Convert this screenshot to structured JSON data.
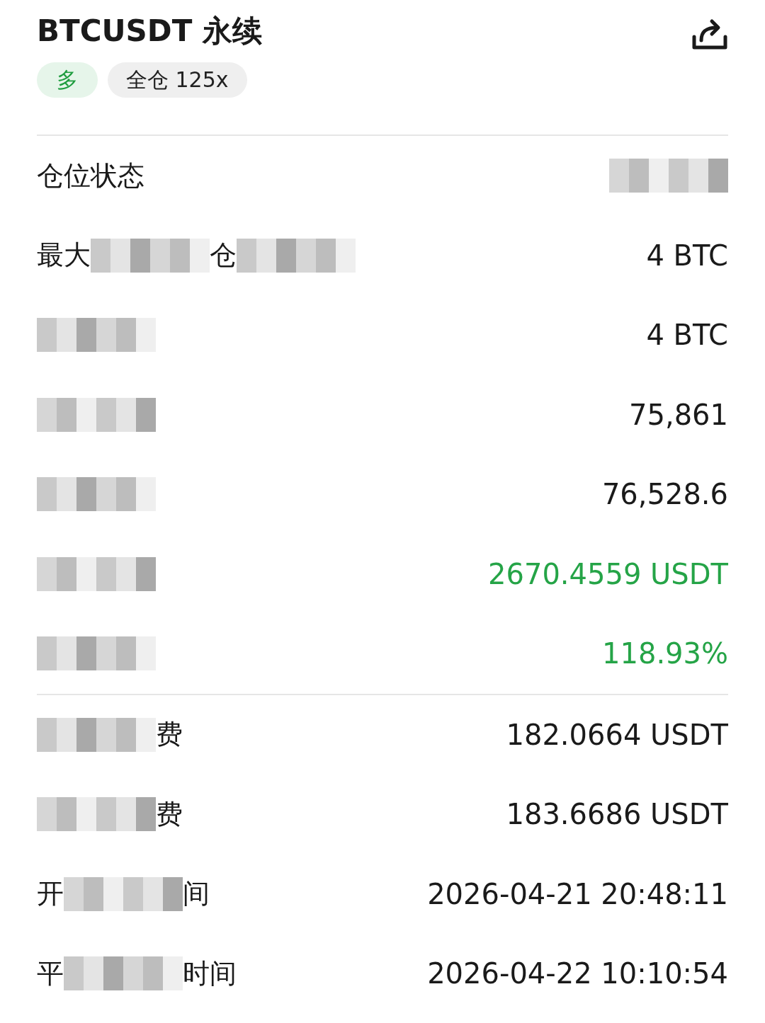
{
  "header": {
    "title": "BTCUSDT 永续",
    "side": "多",
    "margin_mode": "全仓 125x"
  },
  "sections": [
    {
      "rows": [
        {
          "label": [
            {
              "kind": "text",
              "text": "仓位状态"
            }
          ],
          "value_masked": true
        },
        {
          "label": [
            {
              "kind": "text",
              "text": "最大"
            },
            {
              "kind": "mask"
            },
            {
              "kind": "text",
              "text": "仓"
            },
            {
              "kind": "mask"
            }
          ],
          "value": "4 BTC",
          "profit": false
        },
        {
          "label": [
            {
              "kind": "mask"
            }
          ],
          "value": "4 BTC",
          "profit": false
        },
        {
          "label": [
            {
              "kind": "mask"
            }
          ],
          "value": "75,861",
          "profit": false
        },
        {
          "label": [
            {
              "kind": "mask"
            }
          ],
          "value": "76,528.6",
          "profit": false
        },
        {
          "label": [
            {
              "kind": "mask"
            }
          ],
          "value": "2670.4559 USDT",
          "profit": true
        },
        {
          "label": [
            {
              "kind": "mask"
            }
          ],
          "value": "118.93%",
          "profit": true
        }
      ]
    },
    {
      "rows": [
        {
          "label": [
            {
              "kind": "mask"
            },
            {
              "kind": "text",
              "text": "费"
            }
          ],
          "value": "182.0664 USDT",
          "profit": false
        },
        {
          "label": [
            {
              "kind": "mask"
            },
            {
              "kind": "text",
              "text": "费"
            }
          ],
          "value": "183.6686 USDT",
          "profit": false
        },
        {
          "label": [
            {
              "kind": "text",
              "text": "开"
            },
            {
              "kind": "mask"
            },
            {
              "kind": "text",
              "text": "间"
            }
          ],
          "value": "2026-04-21 20:48:11",
          "profit": false
        },
        {
          "label": [
            {
              "kind": "text",
              "text": "平"
            },
            {
              "kind": "mask"
            },
            {
              "kind": "text",
              "text": "时间"
            }
          ],
          "value": "2026-04-22 10:10:54",
          "profit": false
        }
      ]
    }
  ]
}
